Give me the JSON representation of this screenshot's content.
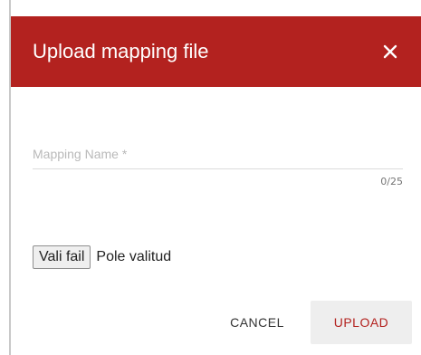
{
  "dialog": {
    "title": "Upload mapping file",
    "close_icon": "close-icon"
  },
  "mapping_name": {
    "value": "",
    "placeholder": "Mapping Name *",
    "counter": "0/25"
  },
  "file_input": {
    "button_label": "Vali fail",
    "status": "Pole valitud"
  },
  "actions": {
    "cancel_label": "CANCEL",
    "upload_label": "UPLOAD"
  },
  "colors": {
    "header_bg": "#b3221f",
    "primary": "#b3221f"
  }
}
